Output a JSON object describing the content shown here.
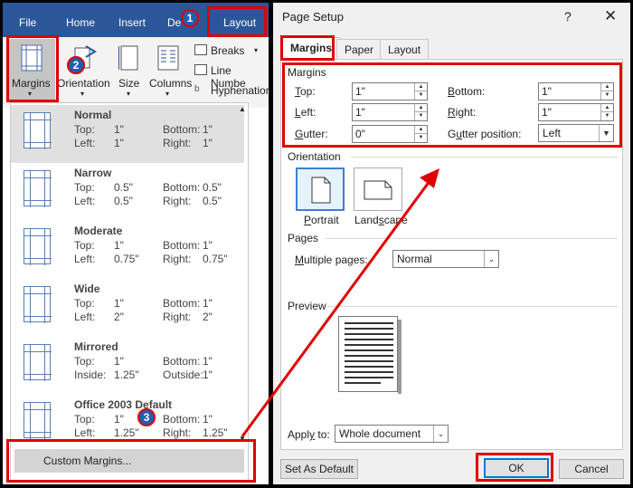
{
  "ribbon": {
    "tabs": [
      {
        "label": "File"
      },
      {
        "label": "Home"
      },
      {
        "label": "Insert"
      },
      {
        "label": "De"
      },
      {
        "label": "Layout"
      }
    ],
    "buttons": {
      "margins": "Margins",
      "orientation": "Orientation",
      "size": "Size",
      "columns": "Columns",
      "breaks": "Breaks",
      "line_numbers": "Line Numbe",
      "hyphenation": "Hyphenation"
    }
  },
  "badges": [
    "1",
    "2",
    "3"
  ],
  "margins_menu": {
    "items": [
      {
        "name": "Normal",
        "row1": [
          "Top:",
          "1\"",
          "Bottom:",
          "1\""
        ],
        "row2": [
          "Left:",
          "1\"",
          "Right:",
          "1\""
        ]
      },
      {
        "name": "Narrow",
        "row1": [
          "Top:",
          "0.5\"",
          "Bottom:",
          "0.5\""
        ],
        "row2": [
          "Left:",
          "0.5\"",
          "Right:",
          "0.5\""
        ]
      },
      {
        "name": "Moderate",
        "row1": [
          "Top:",
          "1\"",
          "Bottom:",
          "1\""
        ],
        "row2": [
          "Left:",
          "0.75\"",
          "Right:",
          "0.75\""
        ]
      },
      {
        "name": "Wide",
        "row1": [
          "Top:",
          "1\"",
          "Bottom:",
          "1\""
        ],
        "row2": [
          "Left:",
          "2\"",
          "Right:",
          "2\""
        ]
      },
      {
        "name": "Mirrored",
        "row1": [
          "Top:",
          "1\"",
          "Bottom:",
          "1\""
        ],
        "row2": [
          "Inside:",
          "1.25\"",
          "Outside:",
          "1\""
        ]
      },
      {
        "name": "Office 2003 Default",
        "row1": [
          "Top:",
          "1\"",
          "Bottom:",
          "1\""
        ],
        "row2": [
          "Left:",
          "1.25\"",
          "Right:",
          "1.25\""
        ]
      }
    ],
    "custom_label": "Custom Margins..."
  },
  "dialog": {
    "title": "Page Setup",
    "help": "?",
    "close": "✕",
    "tabs": [
      {
        "label": "Margins"
      },
      {
        "label": "Paper"
      },
      {
        "label": "Layout"
      }
    ],
    "margins_group": "Margins",
    "fields": {
      "top": {
        "label": "Top:",
        "value": "1\""
      },
      "bottom": {
        "label": "Bottom:",
        "value": "1\""
      },
      "left": {
        "label": "Left:",
        "value": "1\""
      },
      "right": {
        "label": "Right:",
        "value": "1\""
      },
      "gutter": {
        "label": "Gutter:",
        "value": "0\""
      },
      "gutter_position": {
        "label": "Gutter position:",
        "value": "Left"
      }
    },
    "orientation_group": "Orientation",
    "portrait": "Portrait",
    "landscape": "Landscape",
    "pages_group": "Pages",
    "multiple_pages": {
      "label": "Multiple pages:",
      "value": "Normal"
    },
    "preview_group": "Preview",
    "apply_to": {
      "label": "Apply to:",
      "value": "Whole document"
    },
    "set_default": "Set As Default",
    "ok": "OK",
    "cancel": "Cancel"
  },
  "colors": {
    "highlight": "#e00000",
    "ribbon": "#2b579a",
    "badge": "#1e5fb3"
  }
}
